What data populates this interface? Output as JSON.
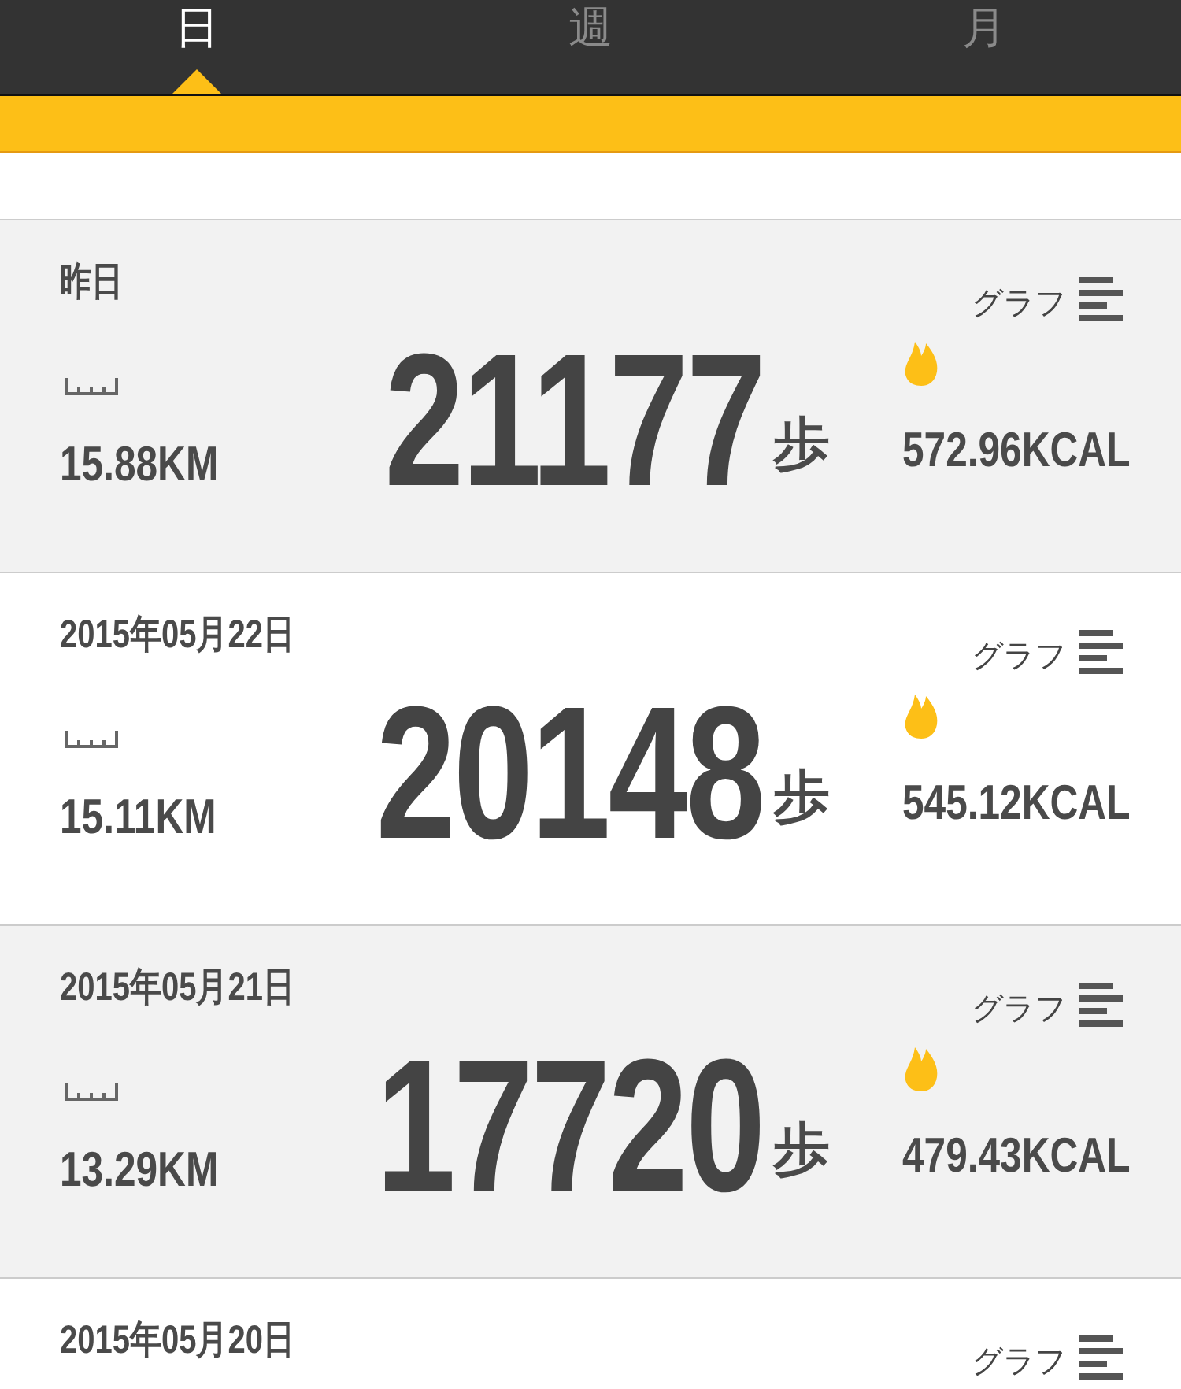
{
  "tabs": [
    {
      "label": "日",
      "selected": true
    },
    {
      "label": "週",
      "selected": false
    },
    {
      "label": "月",
      "selected": false
    }
  ],
  "days": [
    {
      "date": "昨日",
      "distance": "15.88KM",
      "steps": "21177",
      "steps_unit": "歩",
      "graph_label": "グラフ",
      "calories": "572.96KCAL"
    },
    {
      "date": "2015年05月22日",
      "distance": "15.11KM",
      "steps": "20148",
      "steps_unit": "歩",
      "graph_label": "グラフ",
      "calories": "545.12KCAL"
    },
    {
      "date": "2015年05月21日",
      "distance": "13.29KM",
      "steps": "17720",
      "steps_unit": "歩",
      "graph_label": "グラフ",
      "calories": "479.43KCAL"
    },
    {
      "date": "2015年05月20日",
      "graph_label": "グラフ"
    }
  ]
}
